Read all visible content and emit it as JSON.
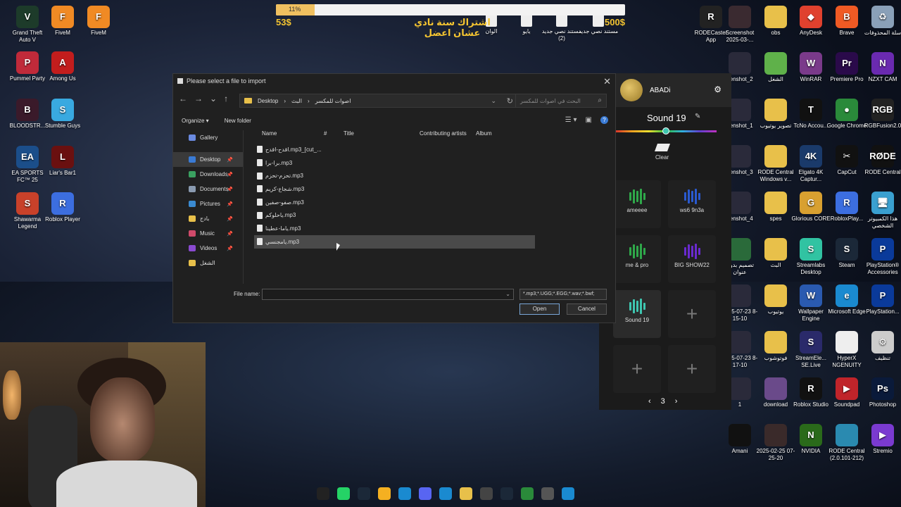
{
  "banner": {
    "progress_text": "11%",
    "progress_value": 0.11,
    "current_amount": "53$",
    "goal_amount": "500$",
    "goal_text": "اشتراك سنة نادي عشان اعضل"
  },
  "desktop_icons_left": [
    {
      "label": "Grand Theft Auto V",
      "icon": "gta-icon",
      "color": "#1d3b2a",
      "glyph": "V"
    },
    {
      "label": "FiveM",
      "icon": "fivem-icon",
      "color": "#f08a24",
      "glyph": "F"
    },
    {
      "label": "FiveM",
      "icon": "fivem-icon",
      "color": "#f08a24",
      "glyph": "F"
    },
    {
      "label": "Pummel Party",
      "icon": "pummel-party-icon",
      "color": "#c02a3a",
      "glyph": "P"
    },
    {
      "label": "Among Us",
      "icon": "among-us-icon",
      "color": "#c21d1d",
      "glyph": "A"
    },
    {
      "label": "BLOODSTR...",
      "icon": "bloodstrike-icon",
      "color": "#3a1a2a",
      "glyph": "B"
    },
    {
      "label": "Stumble Guys",
      "icon": "stumble-guys-icon",
      "color": "#39a9e0",
      "glyph": "S"
    },
    {
      "label": "EA SPORTS FC™ 25",
      "icon": "ea-fc-icon",
      "color": "#1b4e8a",
      "glyph": "EA"
    },
    {
      "label": "Liar's Bar1",
      "icon": "liars-bar-icon",
      "color": "#6a1010",
      "glyph": "L"
    },
    {
      "label": "Shawarma Legend",
      "icon": "shawarma-icon",
      "color": "#c8412a",
      "glyph": "S"
    },
    {
      "label": "Roblox Player",
      "icon": "roblox-player-icon",
      "color": "#3c6ee0",
      "glyph": "R"
    }
  ],
  "desktop_icons_top_mid": [
    {
      "label": "الوان",
      "icon": "document-icon"
    },
    {
      "label": "يايو",
      "icon": "document-icon"
    },
    {
      "label": "مستند نصي جديد (2)",
      "icon": "text-document-icon"
    },
    {
      "label": "مستند نصي جديد",
      "icon": "text-document-icon"
    }
  ],
  "desktop_icons_right": [
    {
      "label": "RODECaster App",
      "icon": "rodecaster-icon",
      "color": "#222",
      "glyph": "R"
    },
    {
      "label": "Screenshot 2025-03-...",
      "icon": "screenshot-icon",
      "color": "#3a2a30",
      "glyph": ""
    },
    {
      "label": "obs",
      "icon": "folder-icon",
      "color": "#e8c04a",
      "glyph": ""
    },
    {
      "label": "AnyDesk",
      "icon": "anydesk-icon",
      "color": "#e0412e",
      "glyph": "◆"
    },
    {
      "label": "Brave",
      "icon": "brave-icon",
      "color": "#f05a24",
      "glyph": "B"
    },
    {
      "label": "سلة المحذوفات",
      "icon": "recycle-bin-icon",
      "color": "#8aa0b8",
      "glyph": "♻"
    },
    {
      "label": "eenshot_2",
      "icon": "screenshot-icon",
      "color": "#2a2a3a",
      "glyph": ""
    },
    {
      "label": "الشغل",
      "icon": "folder-icon",
      "color": "#5fb14a",
      "glyph": ""
    },
    {
      "label": "WinRAR",
      "icon": "winrar-icon",
      "color": "#7a3a8a",
      "glyph": "W"
    },
    {
      "label": "Premiere Pro",
      "icon": "premiere-icon",
      "color": "#2a0a4a",
      "glyph": "Pr"
    },
    {
      "label": "NZXT CAM",
      "icon": "nzxt-icon",
      "color": "#6a2ab0",
      "glyph": "N"
    },
    {
      "label": "eenshot_1",
      "icon": "screenshot-icon",
      "color": "#2a2a3a",
      "glyph": ""
    },
    {
      "label": "تصوير يوتيوب",
      "icon": "folder-icon",
      "color": "#e8c04a",
      "glyph": ""
    },
    {
      "label": "TcNo Accou...",
      "icon": "tcno-icon",
      "color": "#111",
      "glyph": "T"
    },
    {
      "label": "Google Chrome",
      "icon": "chrome-icon",
      "color": "#2a8a3a",
      "glyph": "●"
    },
    {
      "label": "RGBFusion2.0",
      "icon": "rgbfusion-icon",
      "color": "#222",
      "glyph": "RGB"
    },
    {
      "label": "eenshot_3",
      "icon": "screenshot-icon",
      "color": "#2a2a3a",
      "glyph": ""
    },
    {
      "label": "RODE Central Windows v...",
      "icon": "folder-icon",
      "color": "#e8c04a",
      "glyph": ""
    },
    {
      "label": "Elgato 4K Captur...",
      "icon": "elgato-icon",
      "color": "#1a3a6a",
      "glyph": "4K"
    },
    {
      "label": "CapCut",
      "icon": "capcut-icon",
      "color": "#111",
      "glyph": "✂"
    },
    {
      "label": "RODE Central",
      "icon": "rode-central-icon",
      "color": "#111",
      "glyph": "RØDE"
    },
    {
      "label": "eenshot_4",
      "icon": "screenshot-icon",
      "color": "#2a2a3a",
      "glyph": ""
    },
    {
      "label": "spes",
      "icon": "folder-icon",
      "color": "#e8c04a",
      "glyph": ""
    },
    {
      "label": "Glorious CORE",
      "icon": "glorious-icon",
      "color": "#d8a030",
      "glyph": "G"
    },
    {
      "label": "RobloxPlay...",
      "icon": "roblox-player-icon",
      "color": "#3c6ee0",
      "glyph": "R"
    },
    {
      "label": "هذا الكمبيوتر الشخصي",
      "icon": "this-pc-icon",
      "color": "#3aa0d0",
      "glyph": "🖥"
    },
    {
      "label": "تصميم بدون عنوان",
      "icon": "design-file-icon",
      "color": "#2a6a3a",
      "glyph": ""
    },
    {
      "label": "البث",
      "icon": "folder-icon",
      "color": "#e8c04a",
      "glyph": ""
    },
    {
      "label": "Streamlabs Desktop",
      "icon": "streamlabs-icon",
      "color": "#31c3a2",
      "glyph": "S"
    },
    {
      "label": "Steam",
      "icon": "steam-icon",
      "color": "#1b2838",
      "glyph": "S"
    },
    {
      "label": "PlayStation® Accessories",
      "icon": "playstation-icon",
      "color": "#0a3a9a",
      "glyph": "P"
    },
    {
      "label": "2025-07-23 8-15-10",
      "icon": "screenshot-icon",
      "color": "#2a2a3a",
      "glyph": ""
    },
    {
      "label": "يوتيوب",
      "icon": "folder-icon",
      "color": "#e8c04a",
      "glyph": ""
    },
    {
      "label": "Wallpaper Engine",
      "icon": "wallpaper-engine-icon",
      "color": "#2a5ab0",
      "glyph": "W"
    },
    {
      "label": "Microsoft Edge",
      "icon": "edge-icon",
      "color": "#1a8ad0",
      "glyph": "e"
    },
    {
      "label": "PlayStation...",
      "icon": "playstation-icon",
      "color": "#0a3a9a",
      "glyph": "P"
    },
    {
      "label": "2025-07-23 8-17-10",
      "icon": "screenshot-icon",
      "color": "#2a2a3a",
      "glyph": ""
    },
    {
      "label": "فوتوشوب",
      "icon": "folder-icon",
      "color": "#e8c04a",
      "glyph": ""
    },
    {
      "label": "StreamEle... SE.Live",
      "icon": "streamelements-icon",
      "color": "#2a2a6a",
      "glyph": "S"
    },
    {
      "label": "HyperX NGENUITY",
      "icon": "hyperx-icon",
      "color": "#eee",
      "glyph": ""
    },
    {
      "label": "تنظيف",
      "icon": "cleanup-icon",
      "color": "#ccc",
      "glyph": "⚙"
    },
    {
      "label": "1",
      "icon": "screenshot-icon",
      "color": "#2a2a3a",
      "glyph": ""
    },
    {
      "label": "download",
      "icon": "image-file-icon",
      "color": "#6a4a8a",
      "glyph": ""
    },
    {
      "label": "Roblox Studio",
      "icon": "roblox-studio-icon",
      "color": "#111",
      "glyph": "R"
    },
    {
      "label": "Soundpad",
      "icon": "soundpad-icon",
      "color": "#c0242a",
      "glyph": "▶"
    },
    {
      "label": "Photoshop",
      "icon": "photoshop-icon",
      "color": "#0a1a3a",
      "glyph": "Ps"
    },
    {
      "label": "Amani",
      "icon": "amani-icon",
      "color": "#111",
      "glyph": ""
    },
    {
      "label": "2025-02-25 07-25-20",
      "icon": "screenshot-icon",
      "color": "#3a2a2a",
      "glyph": ""
    },
    {
      "label": "NVIDIA",
      "icon": "nvidia-icon",
      "color": "#2a6a1a",
      "glyph": "N"
    },
    {
      "label": "RODE Central (2.0.101-212)",
      "icon": "rode-central-icon",
      "color": "#2a8ab0",
      "glyph": ""
    },
    {
      "label": "Stremio",
      "icon": "stremio-icon",
      "color": "#7a3ad0",
      "glyph": "▶"
    }
  ],
  "dialog": {
    "title": "Please select a file to import",
    "breadcrumb": [
      "Desktop",
      "البث",
      "اصوات للمكسر"
    ],
    "search_placeholder": "البحث في اصوات للمكسر",
    "organize_label": "Organize ▾",
    "new_folder_label": "New folder",
    "sidebar": [
      {
        "label": "Gallery",
        "icon": "gallery-icon",
        "color": "#6a8ae0",
        "pinned": false
      },
      {
        "label": "Desktop",
        "icon": "desktop-icon",
        "color": "#3a7bd5",
        "pinned": true,
        "selected": true
      },
      {
        "label": "Downloads",
        "icon": "downloads-icon",
        "color": "#3aa060",
        "pinned": true
      },
      {
        "label": "Documents",
        "icon": "documents-icon",
        "color": "#8a9ab0",
        "pinned": true
      },
      {
        "label": "Pictures",
        "icon": "pictures-icon",
        "color": "#3a8ad0",
        "pinned": true
      },
      {
        "label": "بادج",
        "icon": "folder-icon",
        "color": "#e8c04a",
        "pinned": true
      },
      {
        "label": "Music",
        "icon": "music-icon",
        "color": "#d04a6a",
        "pinned": true
      },
      {
        "label": "Videos",
        "icon": "videos-icon",
        "color": "#8a4ad0",
        "pinned": true
      },
      {
        "label": "الشغل",
        "icon": "folder-icon",
        "color": "#e8c04a",
        "pinned": false
      }
    ],
    "columns": [
      "Name",
      "#",
      "Title",
      "Contributing artists",
      "Album"
    ],
    "files": [
      {
        "name": "اقدح-اقدح.mp3_[cut_..."
      },
      {
        "name": "برا-برا.mp3"
      },
      {
        "name": "تحزم-تحزم.mp3"
      },
      {
        "name": "شجاع-كريم.mp3"
      },
      {
        "name": "صفو-صفين.mp3"
      },
      {
        "name": "ياحلوكم.mp3"
      },
      {
        "name": "ياما-عطينا.mp3"
      },
      {
        "name": "يامجنسي.mp3",
        "selected": true
      }
    ],
    "file_name_label": "File name:",
    "file_name_value": "",
    "file_type_value": "*.mp3;*.UGG;*.EGG;*.wav;*.bwf;",
    "open_label": "Open",
    "cancel_label": "Cancel"
  },
  "soundboard": {
    "username": "ABADi",
    "sound_title": "Sound 19",
    "clear_label": "Clear",
    "slider_value": 0.5,
    "pads": [
      {
        "label": "ameeee",
        "color": "#2fa84a"
      },
      {
        "label": "ws6 9n3a",
        "color": "#2a5ad0"
      },
      {
        "label": "me & pro",
        "color": "#2fa84a"
      },
      {
        "label": "BIG SHOW22",
        "color": "#6a2ad0"
      },
      {
        "label": "Sound 19",
        "color": "#3ec6b0"
      }
    ],
    "page": "3"
  },
  "taskbar": [
    {
      "icon": "app-icon",
      "color": "#222"
    },
    {
      "icon": "whatsapp-icon",
      "color": "#25d366"
    },
    {
      "icon": "steam-icon",
      "color": "#1b2838"
    },
    {
      "icon": "rockstar-icon",
      "color": "#f5b021"
    },
    {
      "icon": "battlenet-icon",
      "color": "#1a8ad0"
    },
    {
      "icon": "discord-icon",
      "color": "#5865f2"
    },
    {
      "icon": "edge-icon",
      "color": "#1a8ad0"
    },
    {
      "icon": "file-explorer-icon",
      "color": "#e8c04a"
    },
    {
      "icon": "settings-wheel-icon",
      "color": "#444"
    },
    {
      "icon": "steam-icon",
      "color": "#1b2838"
    },
    {
      "icon": "chrome-icon",
      "color": "#2a8a3a"
    },
    {
      "icon": "settings-icon",
      "color": "#555"
    },
    {
      "icon": "windows-start-icon",
      "color": "#1a8ad0"
    }
  ]
}
